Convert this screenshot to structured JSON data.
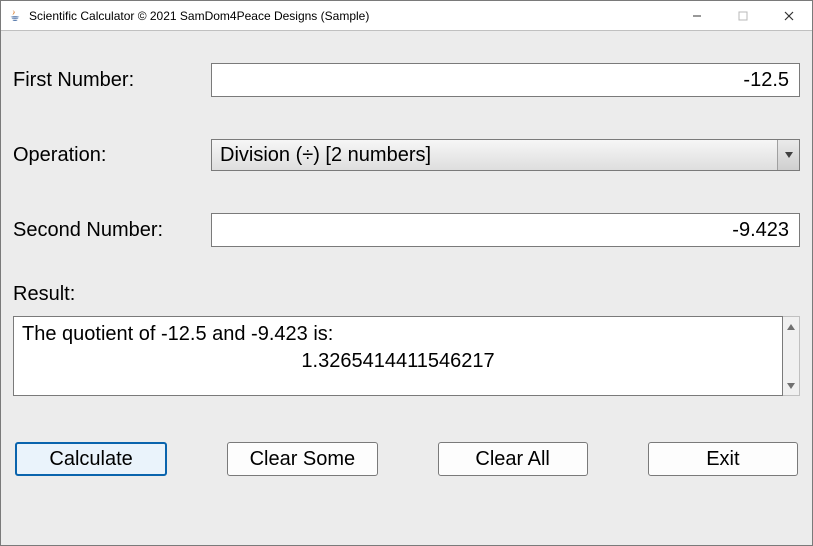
{
  "window": {
    "title": "Scientific Calculator © 2021 SamDom4Peace Designs (Sample)"
  },
  "labels": {
    "first": "First Number:",
    "operation": "Operation:",
    "second": "Second Number:",
    "result": "Result:"
  },
  "inputs": {
    "first": "-12.5",
    "operation": "Division (÷) [2 numbers]",
    "second": "-9.423"
  },
  "result": {
    "line1": "The quotient of -12.5 and -9.423 is:",
    "line2": "1.3265414411546217"
  },
  "buttons": {
    "calculate": "Calculate",
    "clear_some": "Clear Some",
    "clear_all": "Clear All",
    "exit": "Exit"
  }
}
